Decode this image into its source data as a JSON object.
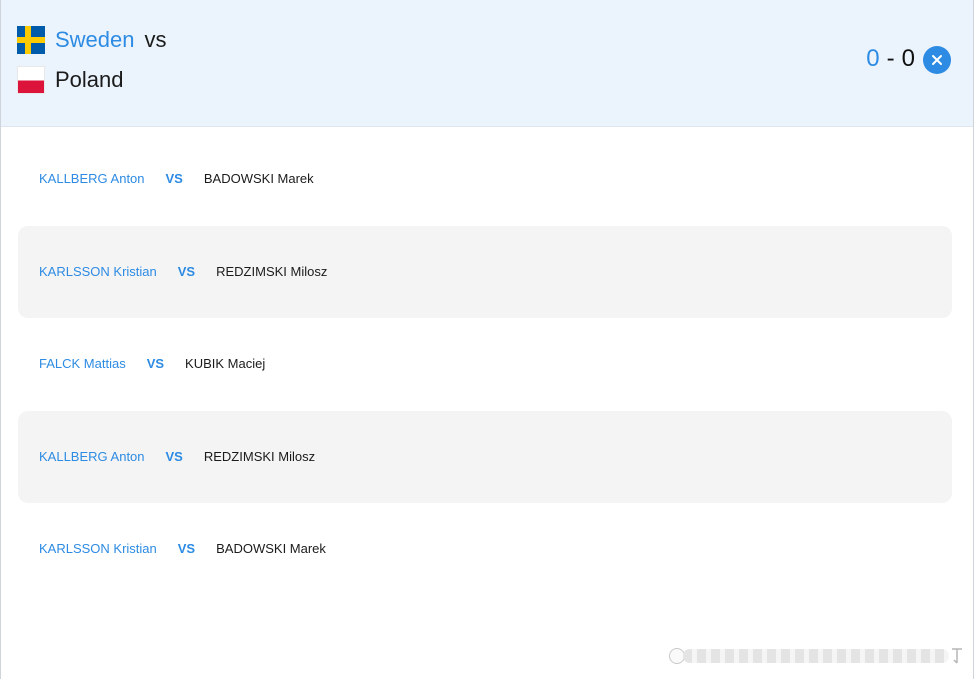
{
  "header": {
    "home_team": "Sweden",
    "vs": "vs",
    "away_team": "Poland",
    "home_flag": "sweden-flag",
    "away_flag": "poland-flag",
    "score": {
      "home": "0",
      "separator": "-",
      "away": "0"
    },
    "close_icon": "close-icon"
  },
  "matches": [
    {
      "home": "KALLBERG Anton",
      "vs": "VS",
      "away": "BADOWSKI Marek"
    },
    {
      "home": "KARLSSON Kristian",
      "vs": "VS",
      "away": "REDZIMSKI Milosz"
    },
    {
      "home": "FALCK Mattias",
      "vs": "VS",
      "away": "KUBIK Maciej"
    },
    {
      "home": "KALLBERG Anton",
      "vs": "VS",
      "away": "REDZIMSKI Milosz"
    },
    {
      "home": "KARLSSON Kristian",
      "vs": "VS",
      "away": "BADOWSKI Marek"
    }
  ],
  "colors": {
    "accent": "#2d8be3",
    "header_bg": "#ebf4fd",
    "row_shade": "#f4f4f4",
    "text": "#1b1b1b"
  }
}
